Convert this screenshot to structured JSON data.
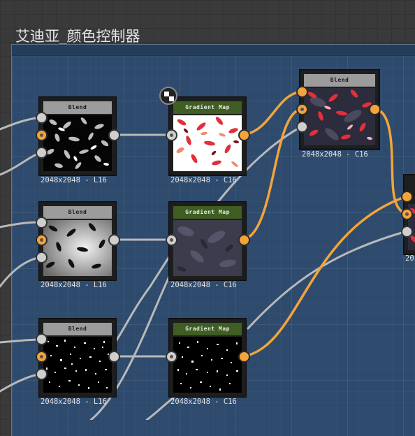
{
  "frame": {
    "title": "艾迪亚_颜色控制器"
  },
  "colors": {
    "frame_bg": "#2e4b6e",
    "wire_grey": "#b9b9b9",
    "wire_orange": "#f3a43a",
    "gradient_header": "#3e5e22",
    "blend_header": "#9c9c9c"
  },
  "nodes": [
    {
      "id": "blend-1",
      "title": "Blend",
      "resolution": "2048x2048 - L16",
      "preview": "grayscale-leaves"
    },
    {
      "id": "gradient-1",
      "title": "Gradient Map",
      "resolution": "2048x2048 - C16",
      "preview": "red-leaves-on-white"
    },
    {
      "id": "blend-top",
      "title": "Blend",
      "resolution": "2048x2048 - C16",
      "preview": "red-leaves-on-dark"
    },
    {
      "id": "blend-2",
      "title": "Blend",
      "resolution": "2048x2048 - L16",
      "preview": "grayscale-noise-leaves"
    },
    {
      "id": "gradient-2",
      "title": "Gradient Map",
      "resolution": "2048x2048 - C16",
      "preview": "dark-grey-texture"
    },
    {
      "id": "blend-3",
      "title": "Blend",
      "resolution": "2048x2048 - L16",
      "preview": "white-dots-on-black"
    },
    {
      "id": "gradient-3",
      "title": "Gradient Map",
      "resolution": "2048x2048 - C16",
      "preview": "white-dots-on-black"
    },
    {
      "id": "blend-partial",
      "title": "",
      "resolution": "20",
      "preview": "partial"
    }
  ],
  "icons": {
    "badge": "checker-badge-icon"
  }
}
